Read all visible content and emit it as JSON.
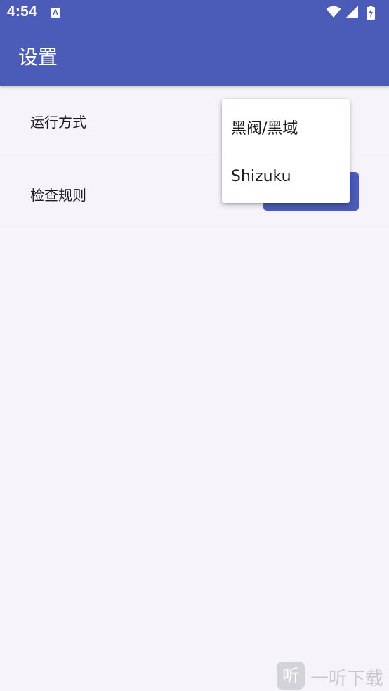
{
  "status_bar": {
    "time": "4:54",
    "app_icon_letter": "A",
    "icons": [
      "wifi-icon",
      "cell-signal-icon",
      "battery-charging-icon"
    ]
  },
  "app_bar": {
    "title": "设置"
  },
  "settings": {
    "run_mode_label": "运行方式",
    "check_rules_label": "检查规则"
  },
  "dropdown": {
    "items": [
      {
        "label": "黑阀/黑域"
      },
      {
        "label": "Shizuku"
      }
    ]
  },
  "watermark": {
    "badge": "听",
    "text": "一听下载"
  },
  "colors": {
    "primary": "#4a5bb8",
    "background": "#f6f4fa",
    "surface": "#ffffff",
    "divider": "#dedde3"
  }
}
